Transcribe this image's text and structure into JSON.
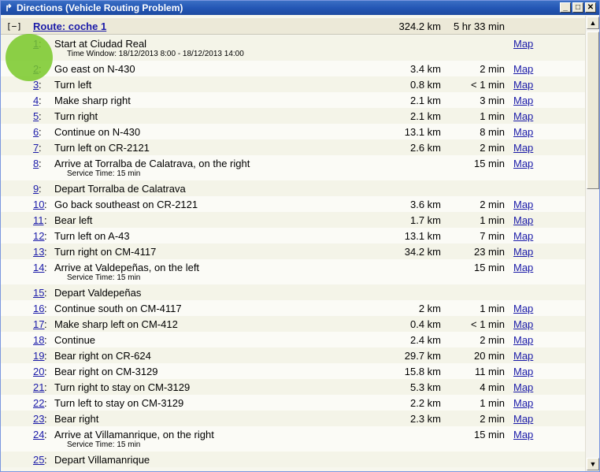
{
  "window": {
    "title": "Directions (Vehicle Routing Problem)",
    "min": "_",
    "max": "□",
    "close": "✕"
  },
  "route": {
    "toggle": "[−]",
    "name": "Route: coche 1",
    "distance": "324.2 km",
    "time": "5 hr 33 min"
  },
  "map_label": "Map",
  "steps": [
    {
      "n": "1",
      "text": "Start at Ciudad Real",
      "sub": "Time Window: 18/12/2013 8:00 - 18/12/2013 14:00",
      "dist": "",
      "time": "",
      "map": true
    },
    {
      "n": "2",
      "text": "Go east on N-430",
      "sub": "",
      "dist": "3.4 km",
      "time": "2 min",
      "map": true
    },
    {
      "n": "3",
      "text": "Turn left",
      "sub": "",
      "dist": "0.8 km",
      "time": "< 1 min",
      "map": true
    },
    {
      "n": "4",
      "text": "Make sharp right",
      "sub": "",
      "dist": "2.1 km",
      "time": "3 min",
      "map": true
    },
    {
      "n": "5",
      "text": "Turn right",
      "sub": "",
      "dist": "2.1 km",
      "time": "1 min",
      "map": true
    },
    {
      "n": "6",
      "text": "Continue on N-430",
      "sub": "",
      "dist": "13.1 km",
      "time": "8 min",
      "map": true
    },
    {
      "n": "7",
      "text": "Turn left on CR-2121",
      "sub": "",
      "dist": "2.6 km",
      "time": "2 min",
      "map": true
    },
    {
      "n": "8",
      "text": "Arrive at Torralba de Calatrava, on the right",
      "sub": "Service Time: 15 min",
      "dist": "",
      "time": "15 min",
      "map": true
    },
    {
      "n": "9",
      "text": "Depart Torralba de Calatrava",
      "sub": "",
      "dist": "",
      "time": "",
      "map": false
    },
    {
      "n": "10",
      "text": "Go back southeast on CR-2121",
      "sub": "",
      "dist": "3.6 km",
      "time": "2 min",
      "map": true
    },
    {
      "n": "11",
      "text": "Bear left",
      "sub": "",
      "dist": "1.7 km",
      "time": "1 min",
      "map": true
    },
    {
      "n": "12",
      "text": "Turn left on A-43",
      "sub": "",
      "dist": "13.1 km",
      "time": "7 min",
      "map": true
    },
    {
      "n": "13",
      "text": "Turn right on CM-4117",
      "sub": "",
      "dist": "34.2 km",
      "time": "23 min",
      "map": true
    },
    {
      "n": "14",
      "text": "Arrive at Valdepeñas, on the left",
      "sub": "Service Time: 15 min",
      "dist": "",
      "time": "15 min",
      "map": true
    },
    {
      "n": "15",
      "text": "Depart Valdepeñas",
      "sub": "",
      "dist": "",
      "time": "",
      "map": false
    },
    {
      "n": "16",
      "text": "Continue south on CM-4117",
      "sub": "",
      "dist": "2 km",
      "time": "1 min",
      "map": true
    },
    {
      "n": "17",
      "text": "Make sharp left on CM-412",
      "sub": "",
      "dist": "0.4 km",
      "time": "< 1 min",
      "map": true
    },
    {
      "n": "18",
      "text": "Continue",
      "sub": "",
      "dist": "2.4 km",
      "time": "2 min",
      "map": true
    },
    {
      "n": "19",
      "text": "Bear right on CR-624",
      "sub": "",
      "dist": "29.7 km",
      "time": "20 min",
      "map": true
    },
    {
      "n": "20",
      "text": "Bear right on CM-3129",
      "sub": "",
      "dist": "15.8 km",
      "time": "11 min",
      "map": true
    },
    {
      "n": "21",
      "text": "Turn right to stay on CM-3129",
      "sub": "",
      "dist": "5.3 km",
      "time": "4 min",
      "map": true
    },
    {
      "n": "22",
      "text": "Turn left to stay on CM-3129",
      "sub": "",
      "dist": "2.2 km",
      "time": "1 min",
      "map": true
    },
    {
      "n": "23",
      "text": "Bear right",
      "sub": "",
      "dist": "2.3 km",
      "time": "2 min",
      "map": true
    },
    {
      "n": "24",
      "text": "Arrive at Villamanrique, on the right",
      "sub": "Service Time: 15 min",
      "dist": "",
      "time": "15 min",
      "map": true
    },
    {
      "n": "25",
      "text": "Depart Villamanrique",
      "sub": "",
      "dist": "",
      "time": "",
      "map": false
    }
  ]
}
